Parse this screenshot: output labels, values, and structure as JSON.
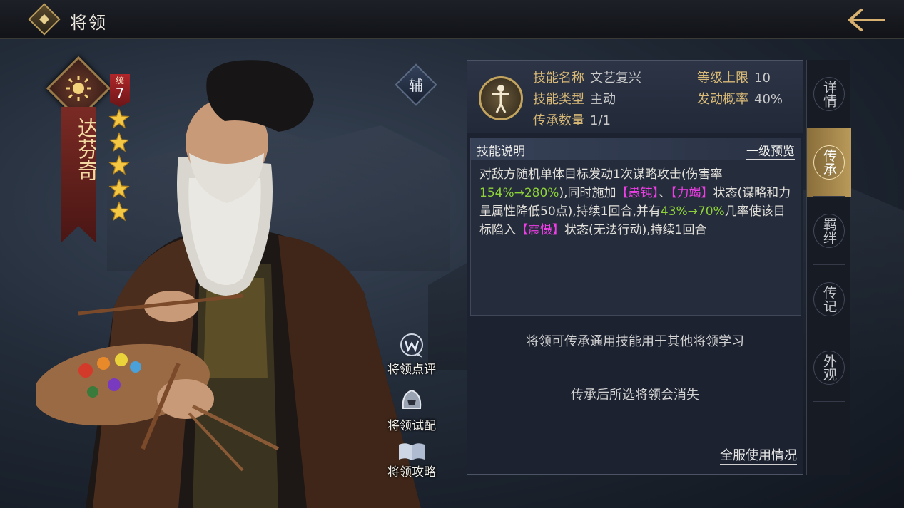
{
  "header": {
    "title": "将领"
  },
  "general": {
    "name": "达芬奇",
    "stat_label": "统",
    "stat_value": "7",
    "stars": 5,
    "role_badge": "辅"
  },
  "actions": [
    {
      "label": "将领点评",
      "icon": "comment-w-icon"
    },
    {
      "label": "将领试配",
      "icon": "helmet-icon"
    },
    {
      "label": "将领攻略",
      "icon": "book-icon"
    }
  ],
  "skill": {
    "name_label": "技能名称",
    "name_value": "文艺复兴",
    "type_label": "技能类型",
    "type_value": "主动",
    "count_label": "传承数量",
    "count_value": "1/1",
    "level_label": "等级上限",
    "level_value": "10",
    "rate_label": "发动概率",
    "rate_value": "40%"
  },
  "description": {
    "title": "技能说明",
    "preview_link": "一级预览",
    "segments": [
      {
        "text": "对敌方随机单体目标发动1次谋略攻击(伤害率",
        "color": "normal"
      },
      {
        "text": "154%→280%",
        "color": "green"
      },
      {
        "text": "),同时施加",
        "color": "normal"
      },
      {
        "text": "【愚钝】",
        "color": "magenta"
      },
      {
        "text": "、",
        "color": "normal"
      },
      {
        "text": "【力竭】",
        "color": "magenta"
      },
      {
        "text": "状态(谋略和力量属性降低50点),持续1回合,并有",
        "color": "normal"
      },
      {
        "text": "43%→70%",
        "color": "green"
      },
      {
        "text": "几率使该目标陷入",
        "color": "normal"
      },
      {
        "text": "【震慑】",
        "color": "magenta"
      },
      {
        "text": "状态(无法行动),持续1回合",
        "color": "normal"
      }
    ]
  },
  "notes": {
    "line1": "将领可传承通用技能用于其他将领学习",
    "line2": "传承后所选将领会消失",
    "usage_link": "全服使用情况"
  },
  "tabs": [
    {
      "label": "详情",
      "active": false
    },
    {
      "label": "传承",
      "active": true
    },
    {
      "label": "羁绊",
      "active": false
    },
    {
      "label": "传记",
      "active": false
    },
    {
      "label": "外观",
      "active": false
    }
  ],
  "colors": {
    "accent_gold": "#d7b876",
    "highlight_green": "#8ed23a",
    "highlight_magenta": "#ee3ee6",
    "ribbon_red": "#7a2a24"
  }
}
